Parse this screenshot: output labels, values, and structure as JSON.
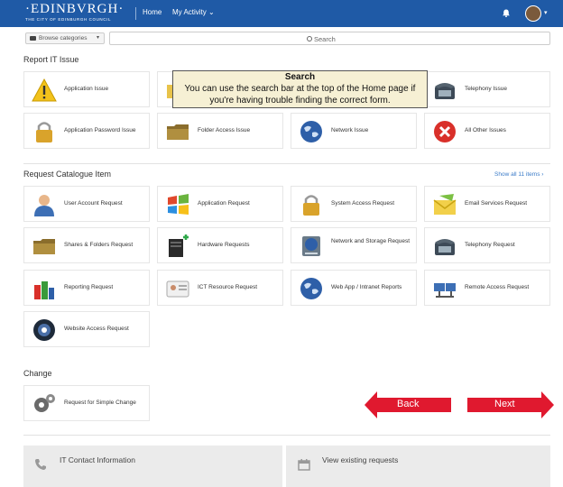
{
  "header": {
    "logo_name": "·EDINBVRGH·",
    "logo_sub": "THE CITY OF EDINBURGH COUNCIL",
    "nav_home": "Home",
    "nav_activity": "My Activity",
    "activity_caret": "⌄"
  },
  "toolbar": {
    "filter_label": "Browse categories",
    "filter_caret": "▾",
    "search_placeholder": "Search"
  },
  "report_section": {
    "title": "Report IT Issue",
    "tiles": [
      {
        "label": "Application Issue",
        "icon": "warning-icon"
      },
      {
        "label": "",
        "icon": "folder-icon"
      },
      {
        "label": "",
        "icon": "globe-icon"
      },
      {
        "label": "Telephony Issue",
        "icon": "telephone-icon"
      },
      {
        "label": "Application Password Issue",
        "icon": "padlock-icon"
      },
      {
        "label": "Folder Access Issue",
        "icon": "folder-icon"
      },
      {
        "label": "Network Issue",
        "icon": "globe-icon"
      },
      {
        "label": "All Other Issues",
        "icon": "red-x-icon"
      }
    ]
  },
  "catalogue_section": {
    "title": "Request Catalogue Item",
    "show_all": "Show all 11 items ›",
    "tiles": [
      {
        "label": "User Account Request",
        "icon": "user-icon"
      },
      {
        "label": "Application Request",
        "icon": "windows-icon"
      },
      {
        "label": "System Access Request",
        "icon": "padlock-icon"
      },
      {
        "label": "Email Services Request",
        "icon": "envelope-icon"
      },
      {
        "label": "Shares & Folders Request",
        "icon": "folder-icon"
      },
      {
        "label": "Hardware Requests",
        "icon": "hardware-icon"
      },
      {
        "label": "Network and Storage Request",
        "icon": "storage-icon"
      },
      {
        "label": "Telephony Request",
        "icon": "telephone-icon"
      },
      {
        "label": "Reporting Request",
        "icon": "bar-chart-icon"
      },
      {
        "label": "ICT Resource Request",
        "icon": "id-card-icon"
      },
      {
        "label": "Web App / Intranet Reports",
        "icon": "globe-icon"
      },
      {
        "label": "Remote Access Request",
        "icon": "network-icon"
      },
      {
        "label": "Website Access Request",
        "icon": "camera-icon"
      }
    ]
  },
  "change_section": {
    "title": "Change",
    "tiles": [
      {
        "label": "Request for Simple Change",
        "icon": "gears-icon"
      }
    ]
  },
  "tooltip": {
    "title": "Search",
    "body": "You can use the search bar at the top of the Home page if you're having trouble finding the correct form."
  },
  "navigation": {
    "back": "Back",
    "next": "Next"
  },
  "footer": {
    "contact": "IT Contact Information",
    "requests": "View existing requests"
  },
  "colors": {
    "brand_blue": "#1f5aa6",
    "arrow_red": "#e0192f",
    "tooltip_bg": "#f6f0d4"
  }
}
